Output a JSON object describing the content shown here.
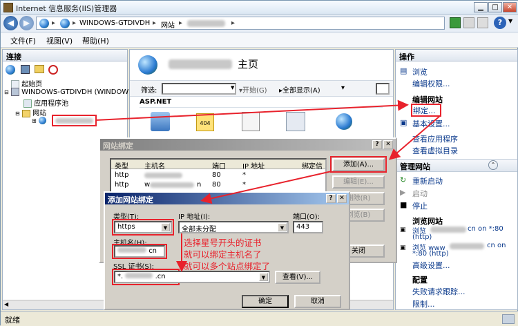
{
  "window": {
    "title": "Internet 信息服务(IIS)管理器"
  },
  "breadcrumb": {
    "server": "WINDOWS-GTDIVDH",
    "sites": "网站"
  },
  "menu": {
    "file": "文件(F)",
    "view": "视图(V)",
    "help": "帮助(H)"
  },
  "connections": {
    "header": "连接",
    "start_page": "起始页",
    "server": "WINDOWS-GTDIVDH (WINDOWS-G",
    "app_pools": "应用程序池",
    "sites": "网站"
  },
  "center": {
    "title_suffix": "主页",
    "filter_label": "筛选:",
    "start_label": "开始(G)",
    "show_all_label": "全部显示(A)",
    "group": "ASP.NET"
  },
  "actions": {
    "header": "操作",
    "browse": "浏览",
    "edit_permissions": "编辑权限...",
    "edit_site": "编辑网站",
    "bindings": "绑定...",
    "basic_settings": "基本设置...",
    "view_apps": "查看应用程序",
    "view_vdirs": "查看虚拟目录",
    "manage_site": "管理网站",
    "restart": "重新启动",
    "start": "启动",
    "stop": "停止",
    "browse_site": "浏览网站",
    "browse1": "浏览",
    "browse1_tail": "cn on *:80",
    "browse1_proto": "(http)",
    "browse2": "浏览 www",
    "browse2_tail": "cn on",
    "browse2_proto": "*:80 (http)",
    "advanced": "高级设置...",
    "config": "配置",
    "failed_req": "失败请求跟踪...",
    "limits": "限制..."
  },
  "site_bindings": {
    "title": "网站绑定",
    "columns": [
      "类型",
      "主机名",
      "端口",
      "IP 地址",
      "绑定信"
    ],
    "rows": [
      {
        "type": "http",
        "port": "80",
        "ip": "*"
      },
      {
        "type": "http",
        "port": "80",
        "ip": "*"
      }
    ],
    "host2_prefix": "w",
    "host2_suffix": "n",
    "add": "添加(A)...",
    "edit": "编辑(E)...",
    "remove": "删除(R)",
    "browse": "浏览(B)",
    "close": "关闭"
  },
  "add_binding": {
    "title": "添加网站绑定",
    "type_label": "类型(T):",
    "type_value": "https",
    "ip_label": "IP 地址(I):",
    "ip_value": "全部未分配",
    "port_label": "端口(O):",
    "port_value": "443",
    "host_label": "主机名(H):",
    "host_value": "cn",
    "ssl_label": "SSL 证书(S):",
    "ssl_value_prefix": "*.",
    "ssl_value_suffix": ".cn",
    "view": "查看(V)...",
    "ok": "确定",
    "cancel": "取消"
  },
  "annotation": {
    "line1": "选择星号开头的证书",
    "line2": "就可以绑定主机名了",
    "line3": "就可以多个站点绑定了"
  },
  "status": {
    "text": "就绪"
  },
  "colors": {
    "annotation": "#e8222c",
    "link": "#0b3a8c",
    "title_active": "#0a246a"
  }
}
